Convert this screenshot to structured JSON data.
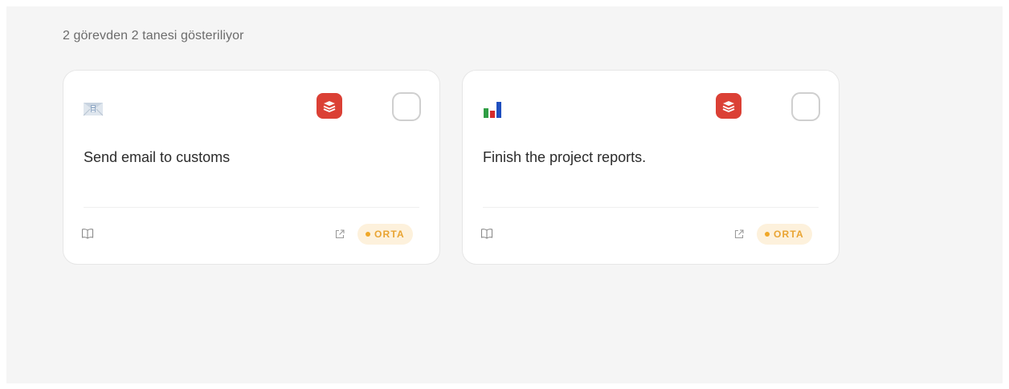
{
  "summary": {
    "text": "2 görevden 2 tanesi gösteriliyor"
  },
  "colors": {
    "panel_bg": "#f5f5f5",
    "todoist_red": "#db4035",
    "priority_text": "#e9a432",
    "priority_bg": "#fdf1dc"
  },
  "tasks": [
    {
      "icon": "envelope-icon",
      "source_icon": "todoist-icon",
      "title": "Send email to customs",
      "priority": "ORTA",
      "completed": false
    },
    {
      "icon": "bar-chart-icon",
      "source_icon": "todoist-icon",
      "title": "Finish the project reports.",
      "priority": "ORTA",
      "completed": false
    }
  ]
}
